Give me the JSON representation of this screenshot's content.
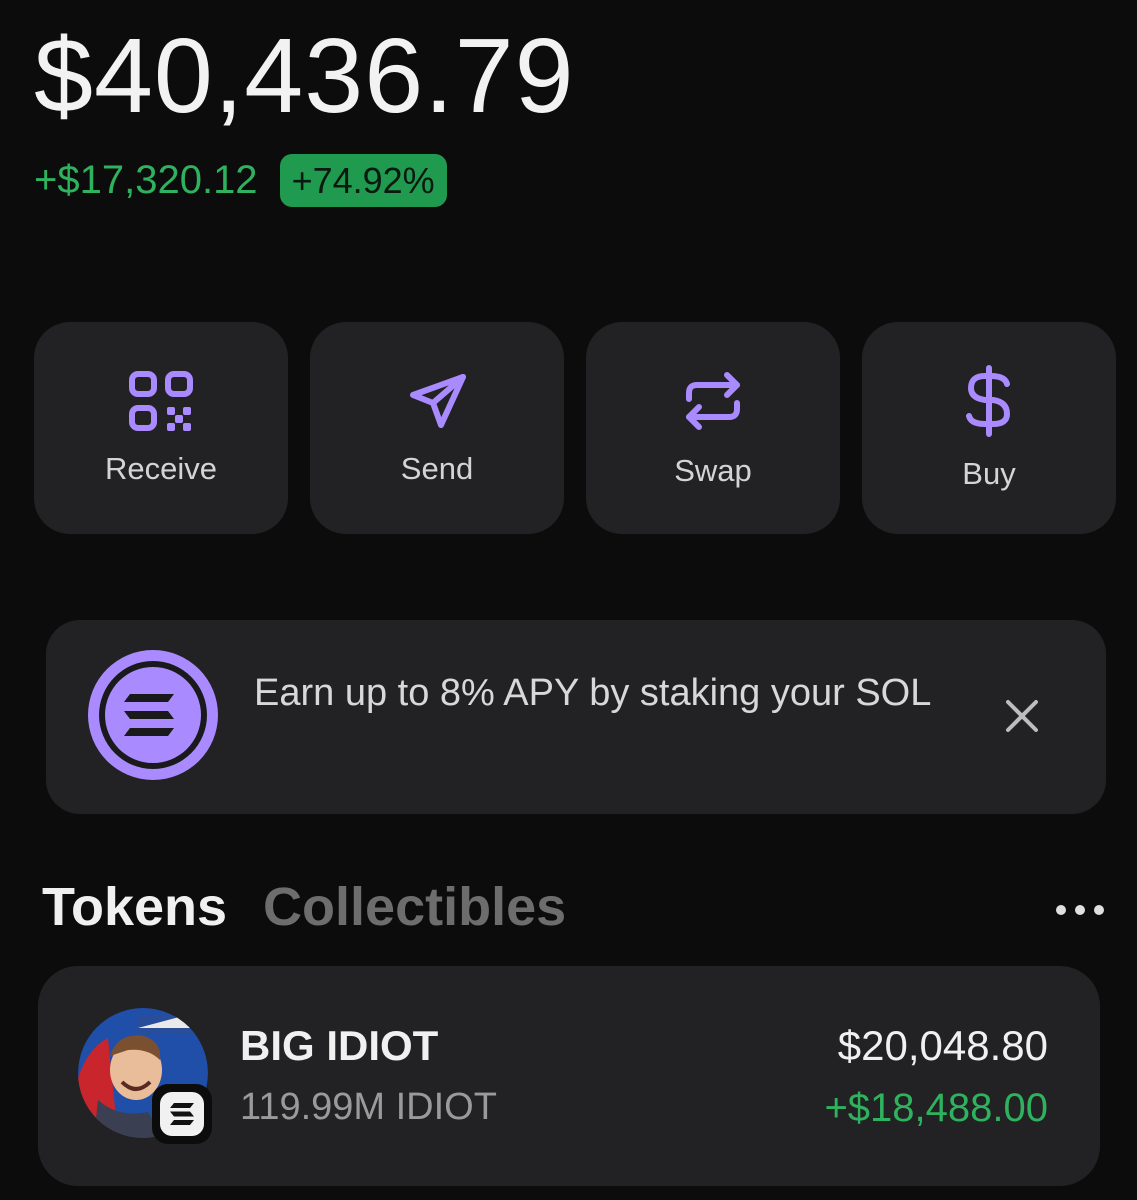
{
  "portfolio": {
    "balance": "$40,436.79",
    "change_amount": "+$17,320.12",
    "change_percent": "+74.92%"
  },
  "actions": [
    {
      "label": "Receive",
      "icon": "qr-code-icon"
    },
    {
      "label": "Send",
      "icon": "send-icon"
    },
    {
      "label": "Swap",
      "icon": "swap-icon"
    },
    {
      "label": "Buy",
      "icon": "dollar-icon"
    }
  ],
  "banner": {
    "text": "Earn up to 8% APY by staking your SOL",
    "icon": "solana-logo-icon",
    "close_icon": "close-icon"
  },
  "tabs": [
    {
      "label": "Tokens",
      "active": true
    },
    {
      "label": "Collectibles",
      "active": false
    }
  ],
  "tokens": [
    {
      "name": "BIG IDIOT",
      "amount": "119.99M IDIOT",
      "value": "$20,048.80",
      "change": "+$18,488.00",
      "chain_icon": "solana-icon"
    }
  ],
  "colors": {
    "background": "#0c0c0c",
    "card": "#222224",
    "accent_purple": "#a98bff",
    "positive_green": "#2fb25e",
    "badge_green": "#1f9a4f"
  }
}
